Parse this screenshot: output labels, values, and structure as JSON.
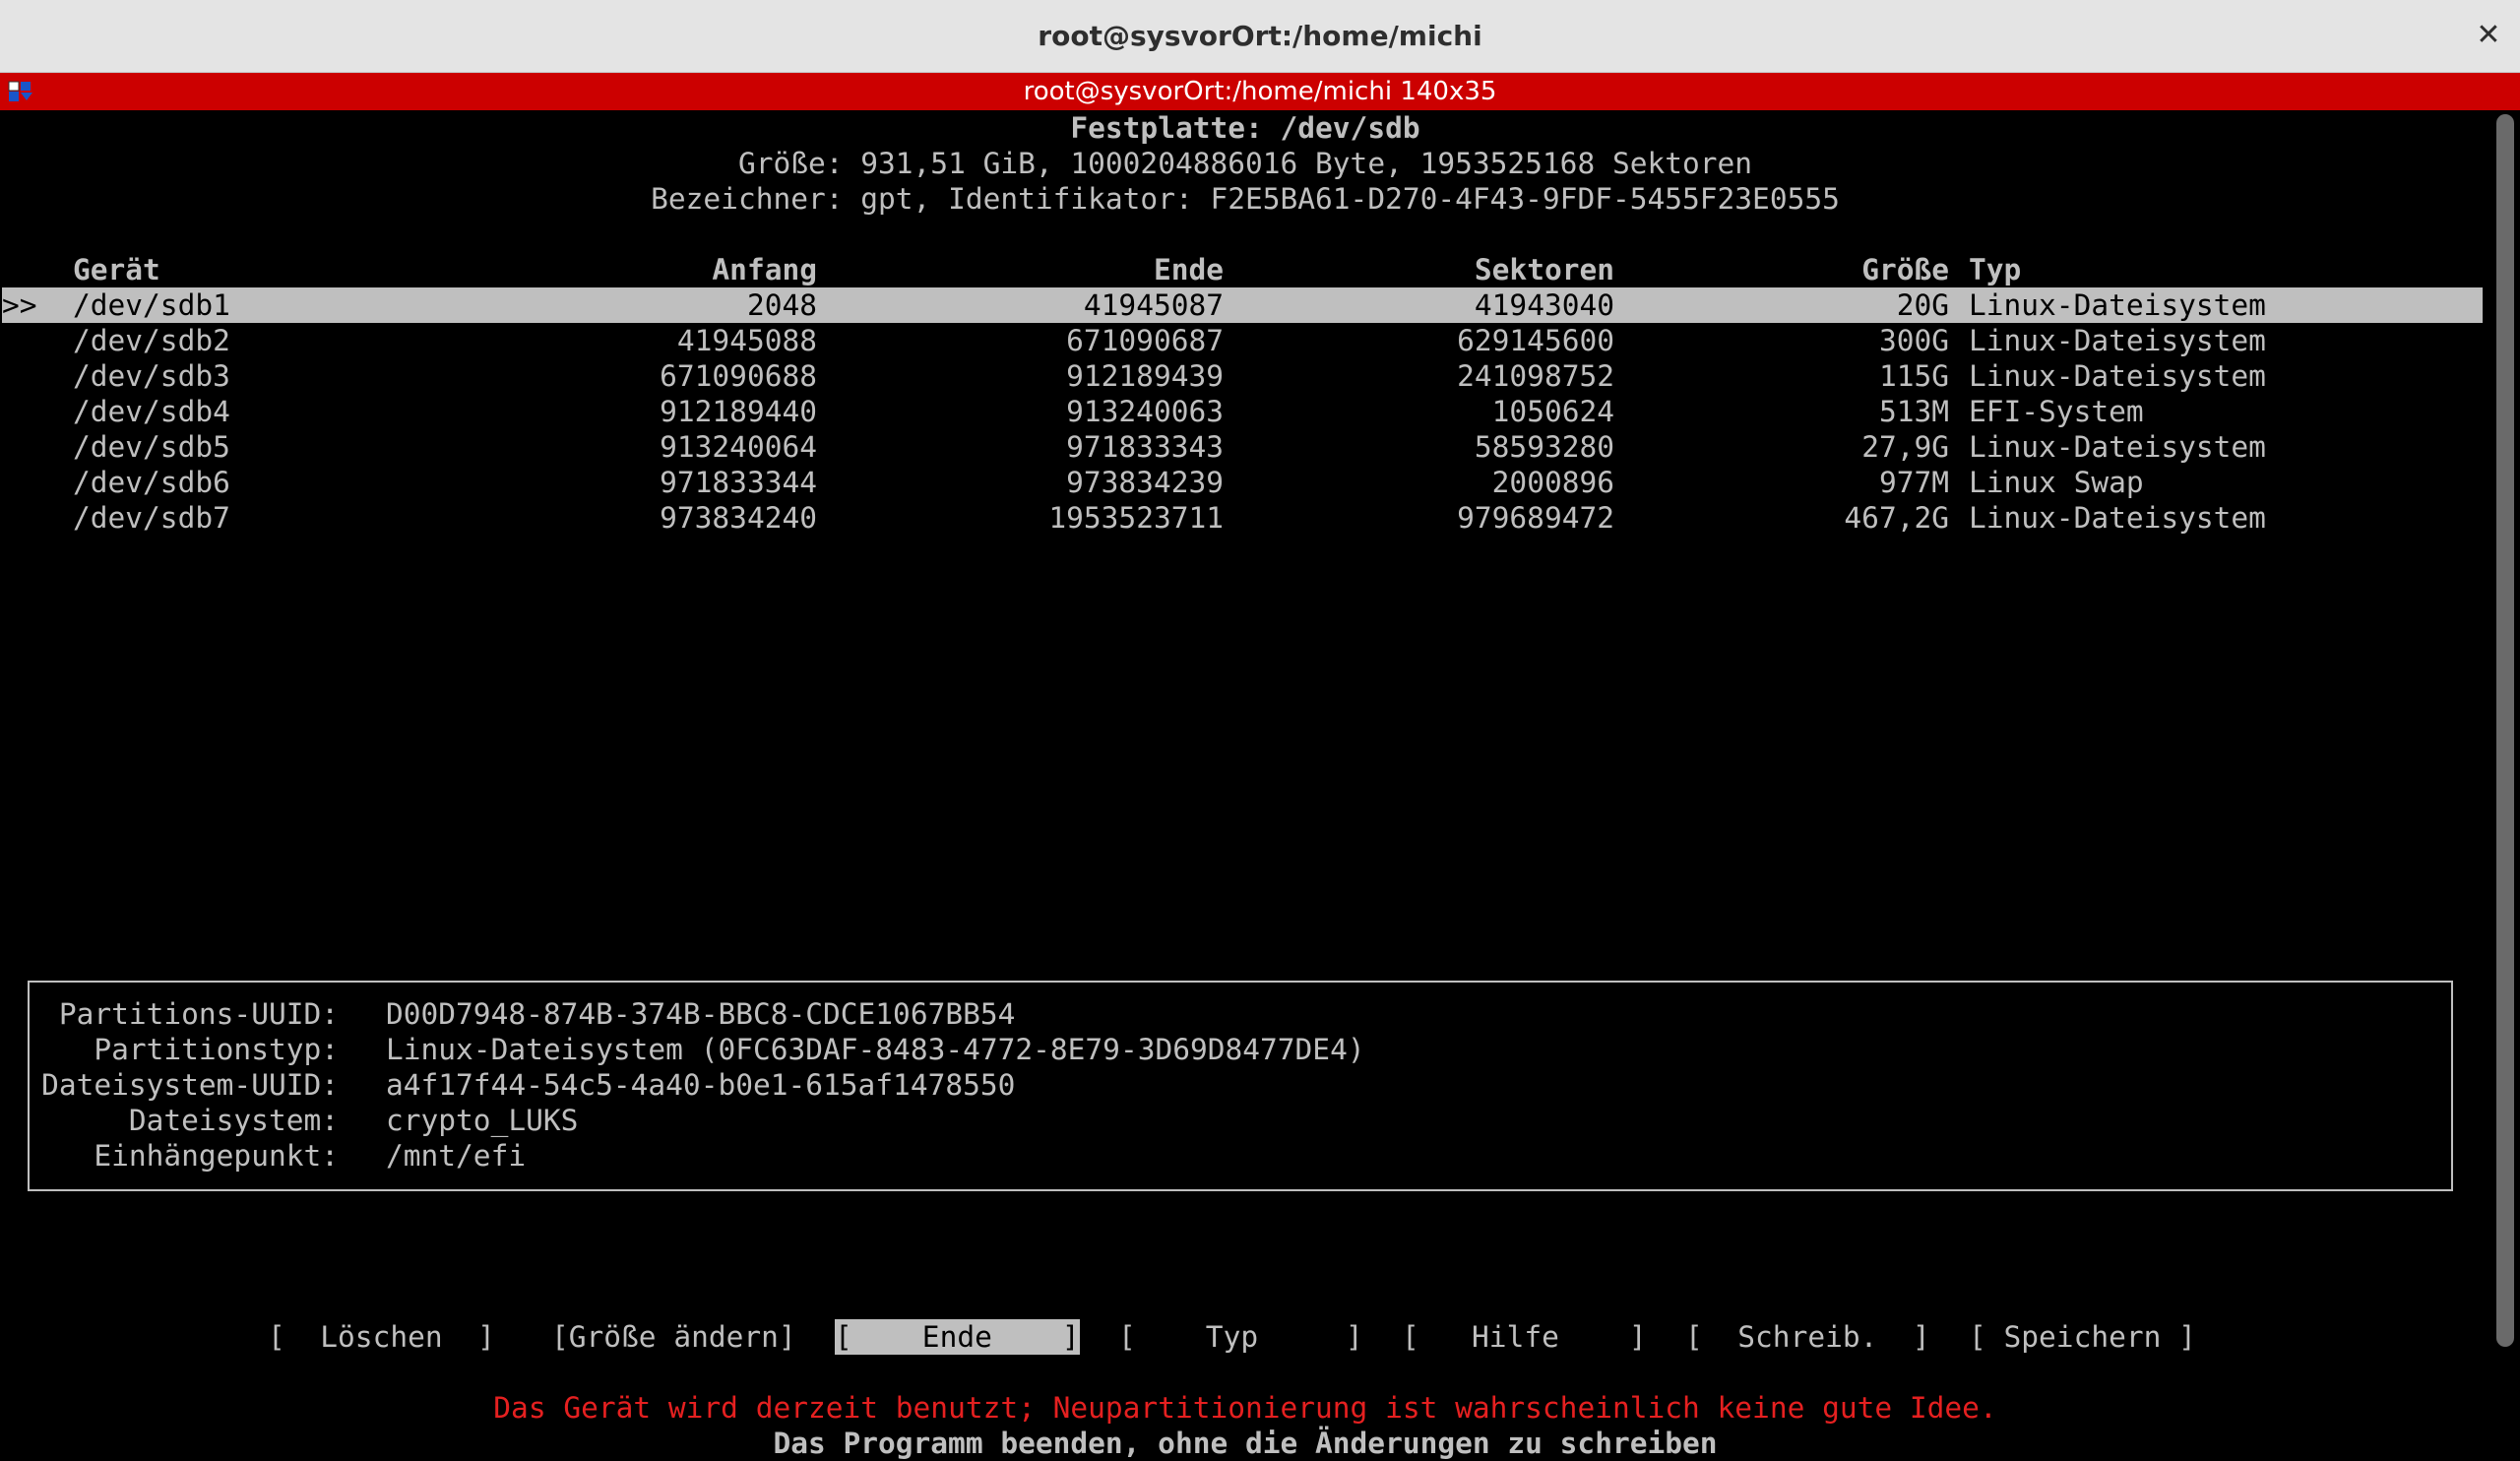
{
  "window": {
    "title": "root@sysvorOrt:/home/michi",
    "close_glyph": "✕"
  },
  "terminal_header": {
    "title": "root@sysvorOrt:/home/michi 140x35"
  },
  "disk": {
    "heading": "Festplatte: /dev/sdb",
    "size_line": "Größe: 931,51 GiB, 1000204886016 Byte, 1953525168 Sektoren",
    "label_line": "Bezeichner: gpt, Identifikator: F2E5BA61-D270-4F43-9FDF-5455F23E0555"
  },
  "table": {
    "headers": {
      "device": "Gerät",
      "start": "Anfang",
      "end": "Ende",
      "sectors": "Sektoren",
      "size": "Größe",
      "type": "Typ"
    },
    "selection_marker": ">>",
    "rows": [
      {
        "device": "/dev/sdb1",
        "start": "2048",
        "end": "41945087",
        "sectors": "41943040",
        "size": "20G",
        "type": "Linux-Dateisystem"
      },
      {
        "device": "/dev/sdb2",
        "start": "41945088",
        "end": "671090687",
        "sectors": "629145600",
        "size": "300G",
        "type": "Linux-Dateisystem"
      },
      {
        "device": "/dev/sdb3",
        "start": "671090688",
        "end": "912189439",
        "sectors": "241098752",
        "size": "115G",
        "type": "Linux-Dateisystem"
      },
      {
        "device": "/dev/sdb4",
        "start": "912189440",
        "end": "913240063",
        "sectors": "1050624",
        "size": "513M",
        "type": "EFI-System"
      },
      {
        "device": "/dev/sdb5",
        "start": "913240064",
        "end": "971833343",
        "sectors": "58593280",
        "size": "27,9G",
        "type": "Linux-Dateisystem"
      },
      {
        "device": "/dev/sdb6",
        "start": "971833344",
        "end": "973834239",
        "sectors": "2000896",
        "size": "977M",
        "type": "Linux Swap"
      },
      {
        "device": "/dev/sdb7",
        "start": "973834240",
        "end": "1953523711",
        "sectors": "979689472",
        "size": "467,2G",
        "type": "Linux-Dateisystem"
      }
    ]
  },
  "details": [
    {
      "label": "Partitions-UUID:",
      "value": "D00D7948-874B-374B-BBC8-CDCE1067BB54"
    },
    {
      "label": "Partitionstyp:",
      "value": "Linux-Dateisystem (0FC63DAF-8483-4772-8E79-3D69D8477DE4)"
    },
    {
      "label": "Dateisystem-UUID:",
      "value": "a4f17f44-54c5-4a40-b0e1-615af1478550"
    },
    {
      "label": "Dateisystem:",
      "value": "crypto_LUKS"
    },
    {
      "label": "Einhängepunkt:",
      "value": "/mnt/efi"
    }
  ],
  "menu": {
    "delete": "[  Löschen  ]",
    "resize": "[Größe ändern]",
    "quit": "[    Ende    ]",
    "type": "[    Typ     ]",
    "help": "[   Hilfe    ]",
    "write": "[  Schreib.  ]",
    "dump": "[ Speichern ]"
  },
  "status": {
    "warning": "Das Gerät wird derzeit benutzt; Neupartitionierung ist wahrscheinlich keine gute Idee.",
    "hint": "Das Programm beenden, ohne die Änderungen zu schreiben"
  },
  "colors": {
    "terminal_header": "#cc0000",
    "terminal_text": "#bfbfbf",
    "warning_text": "#e52020",
    "selection_bg": "#bfbfbf"
  }
}
